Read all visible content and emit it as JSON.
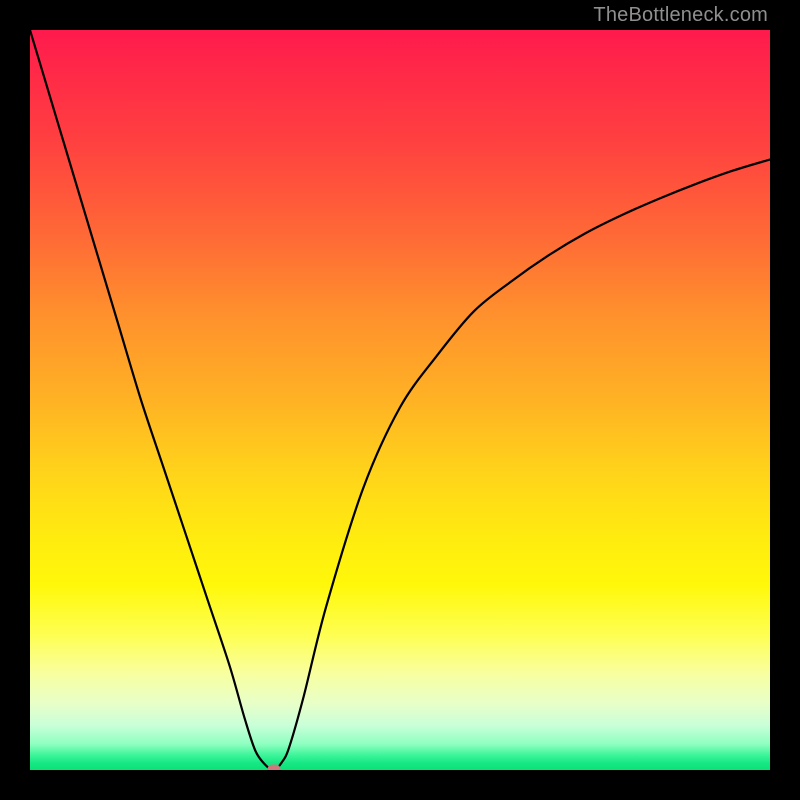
{
  "watermark": "TheBottleneck.com",
  "chart_data": {
    "type": "line",
    "title": "",
    "xlabel": "",
    "ylabel": "",
    "xlim": [
      0,
      100
    ],
    "ylim": [
      0,
      100
    ],
    "grid": false,
    "background_gradient": {
      "stops": [
        {
          "pos": 0,
          "color": "#ff1a4d"
        },
        {
          "pos": 15,
          "color": "#ff4040"
        },
        {
          "pos": 38,
          "color": "#ff8f2d"
        },
        {
          "pos": 60,
          "color": "#ffd41a"
        },
        {
          "pos": 82,
          "color": "#feff55"
        },
        {
          "pos": 94,
          "color": "#c8ffd8"
        },
        {
          "pos": 100,
          "color": "#0be278"
        }
      ]
    },
    "series": [
      {
        "name": "bottleneck-curve",
        "color": "#000000",
        "x": [
          0,
          3,
          6,
          9,
          12,
          15,
          18,
          21,
          24,
          27,
          29,
          30.5,
          32,
          33,
          34,
          35,
          37,
          40,
          45,
          50,
          55,
          60,
          65,
          70,
          75,
          80,
          85,
          90,
          95,
          100
        ],
        "y": [
          100,
          90,
          80,
          70,
          60,
          50,
          41,
          32,
          23,
          14,
          7,
          2.5,
          0.5,
          0,
          1,
          3,
          10,
          22,
          38,
          49,
          56,
          62,
          66,
          69.5,
          72.5,
          75,
          77.2,
          79.2,
          81,
          82.5
        ]
      }
    ],
    "marker": {
      "name": "optimal-point",
      "x": 33,
      "y": 0.2,
      "color": "#cc7a80"
    }
  }
}
